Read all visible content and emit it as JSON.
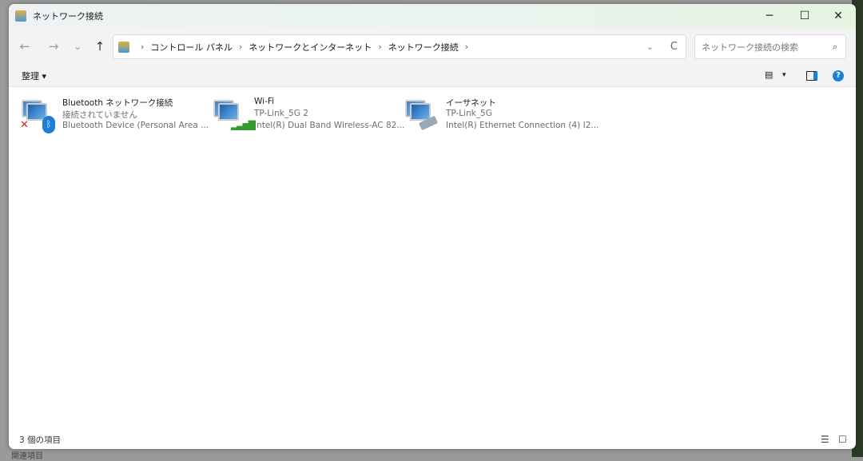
{
  "window": {
    "title": "ネットワーク接続",
    "minimize": "─",
    "maximize": "☐",
    "close": "✕"
  },
  "nav": {
    "back": "←",
    "forward": "→",
    "recent": "⌄",
    "up": "↑"
  },
  "breadcrumb": [
    "コントロール パネル",
    "ネットワークとインターネット",
    "ネットワーク接続"
  ],
  "breadcrumb_sep": "›",
  "address_dropdown": "⌄",
  "refresh": "C",
  "search": {
    "placeholder": "ネットワーク接続の検索",
    "icon": "⌕"
  },
  "toolbar": {
    "organize": "整理 ▾",
    "view": "▾"
  },
  "items": [
    {
      "name": "Bluetooth ネットワーク接続",
      "status": "接続されていません",
      "device": "Bluetooth Device (Personal Area ...",
      "badge": "disconnected-x"
    },
    {
      "name": "Wi-Fi",
      "status": "TP-Link_5G 2",
      "device": "Intel(R) Dual Band Wireless-AC 82...",
      "badge": "wifi-signal"
    },
    {
      "name": "イーサネット",
      "status": "TP-Link_5G",
      "device": "Intel(R) Ethernet Connection (4) I2...",
      "badge": "ethernet-cable"
    }
  ],
  "statusbar": {
    "count": "3 個の項目"
  },
  "background": {
    "text": "関連項目"
  },
  "colors": {
    "accent": "#1a7fd6",
    "error": "#d62020",
    "wifi": "#2e9d2e"
  }
}
